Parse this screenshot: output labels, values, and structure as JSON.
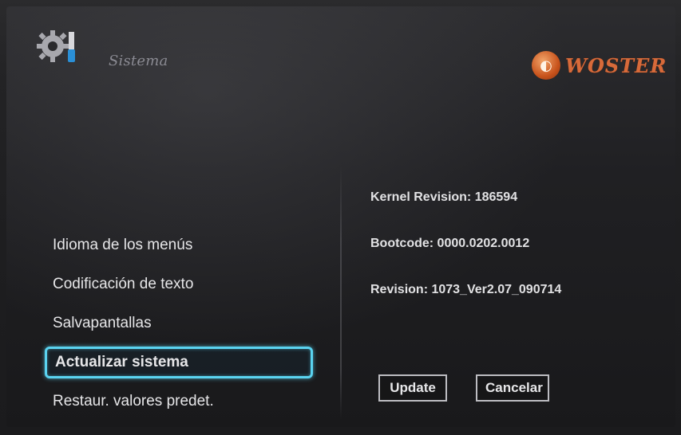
{
  "header": {
    "title": "Sistema",
    "icon": "gear-screwdriver-icon",
    "brand_name": "WOSTER",
    "brand_icon": "woster-logo-icon"
  },
  "menu": {
    "items": [
      {
        "label": "Idioma de los menús"
      },
      {
        "label": "Codificación de texto"
      },
      {
        "label": "Salvapantallas"
      },
      {
        "label": "Actualizar sistema",
        "selected": true
      },
      {
        "label": "Restaur. valores predet."
      }
    ]
  },
  "info": {
    "kernel": "Kernel Revision: 186594",
    "bootcode": "Bootcode: 0000.0202.0012",
    "revision": "Revision: 1073_Ver2.07_090714"
  },
  "actions": {
    "update_label": "Update",
    "cancel_label": "Cancelar"
  },
  "colors": {
    "selection_border": "#5ad3f0",
    "brand": "#d76a3a",
    "background": "#1e1e20"
  }
}
